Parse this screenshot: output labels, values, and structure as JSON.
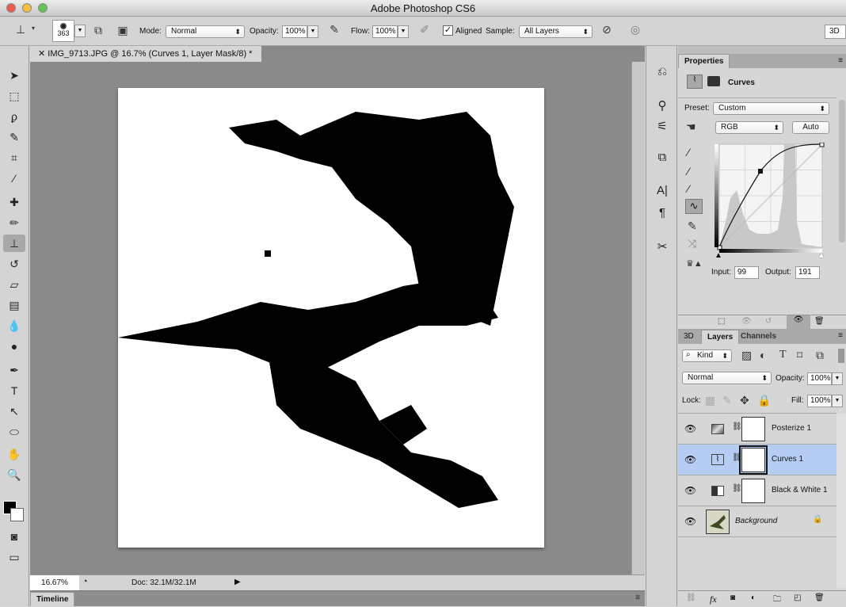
{
  "app": {
    "title": "Adobe Photoshop CS6"
  },
  "options": {
    "brush_size": "363",
    "mode_label": "Mode:",
    "mode": "Normal",
    "opacity_label": "Opacity:",
    "opacity": "100%",
    "flow_label": "Flow:",
    "flow": "100%",
    "aligned_label": "Aligned",
    "aligned_checked": true,
    "sample_label": "Sample:",
    "sample": "All Layers",
    "workspace": "3D"
  },
  "document": {
    "tab_title": "IMG_9713.JPG @ 16.7% (Curves 1, Layer Mask/8) *",
    "zoom": "16.67%",
    "doc_size": "Doc: 32.1M/32.1M"
  },
  "timeline": {
    "label": "Timeline"
  },
  "properties": {
    "tab": "Properties",
    "type": "Curves",
    "preset_label": "Preset:",
    "preset": "Custom",
    "channel": "RGB",
    "auto_label": "Auto",
    "input_label": "Input:",
    "input": "99",
    "output_label": "Output:",
    "output": "191"
  },
  "layers_panel": {
    "tabs": [
      "3D",
      "Layers",
      "Channels"
    ],
    "filter": "Kind",
    "blend_mode": "Normal",
    "opacity_label": "Opacity:",
    "opacity": "100%",
    "lock_label": "Lock:",
    "fill_label": "Fill:",
    "fill": "100%",
    "layers": [
      {
        "name": "Posterize 1",
        "selected": false
      },
      {
        "name": "Curves 1",
        "selected": true
      },
      {
        "name": "Black & White 1",
        "selected": false
      },
      {
        "name": "Background",
        "selected": false,
        "locked": true
      }
    ]
  },
  "colors": {
    "selection": "#b5cdf2",
    "canvas_bg": "#8a8a8a"
  }
}
